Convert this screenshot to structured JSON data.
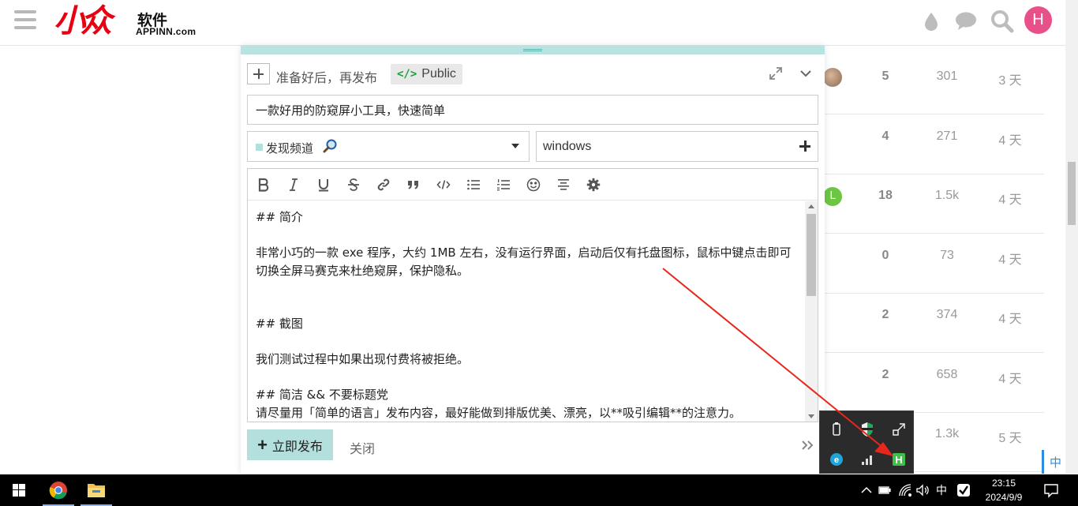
{
  "header": {
    "logo_cn": "小众",
    "logo_soft": "软件",
    "logo_domain": "APPINN.com",
    "avatar_letter": "H",
    "icons": [
      "menu-icon",
      "water-drop-icon",
      "chat-bubble-icon",
      "search-icon"
    ]
  },
  "topics": [
    {
      "replies": "5",
      "views": "301",
      "activity": "3 天",
      "avatar": "photo"
    },
    {
      "replies": "4",
      "views": "271",
      "activity": "4 天",
      "avatar": ""
    },
    {
      "replies": "18",
      "views": "1.5k",
      "activity": "4 天",
      "avatar": "L"
    },
    {
      "replies": "0",
      "views": "73",
      "activity": "4 天",
      "avatar": ""
    },
    {
      "replies": "2",
      "views": "374",
      "activity": "4 天",
      "avatar": ""
    },
    {
      "replies": "2",
      "views": "658",
      "activity": "4 天",
      "avatar": ""
    },
    {
      "replies": "",
      "views": "1.3k",
      "activity": "5 天",
      "avatar": ""
    }
  ],
  "composer": {
    "action_title": "准备好后，再发布",
    "visibility_icon": "</>",
    "visibility_label": "Public",
    "title_value": "一款好用的防窥屏小工具，快速简单",
    "category_label": "发现频道",
    "category_color": "#b3e0dc",
    "tag_value": "windows",
    "toolbar_buttons": [
      "bold",
      "italic",
      "underline",
      "strikethrough",
      "link",
      "quote",
      "code",
      "bullet-list",
      "numbered-list",
      "emoji",
      "align-center",
      "settings"
    ],
    "body": "## 简介\n\n非常小巧的一款 exe 程序，大约 1MB 左右，没有运行界面，启动后仅有托盘图标，鼠标中键点击即可切换全屏马赛克来杜绝窥屏，保护隐私。\n\n\n## 截图\n\n我们测试过程中如果出现付费将被拒绝。\n\n## 简洁 && 不要标题党\n请尽量用「简单的语言」发布内容，最好能做到排版优美、漂亮，以**吸引编辑**的注意力。",
    "submit_plus": "+",
    "submit_label": "立即发布",
    "close_label": "关闭"
  },
  "tray_popup": {
    "icons": [
      "usb-icon",
      "shield-icon",
      "resize-icon",
      "edge-icon",
      "signal-bars-icon",
      "h-app-icon"
    ]
  },
  "ime_float": "中",
  "taskbar": {
    "apps": [
      "chrome-icon",
      "file-explorer-icon"
    ],
    "ime": "中",
    "time": "23:15",
    "date": "2024/9/9"
  },
  "colors": {
    "brand_red": "#e60012",
    "accent_teal": "#b3e0dc",
    "avatar_pink": "#e8508a",
    "annotation_arrow": "#e8261c"
  }
}
